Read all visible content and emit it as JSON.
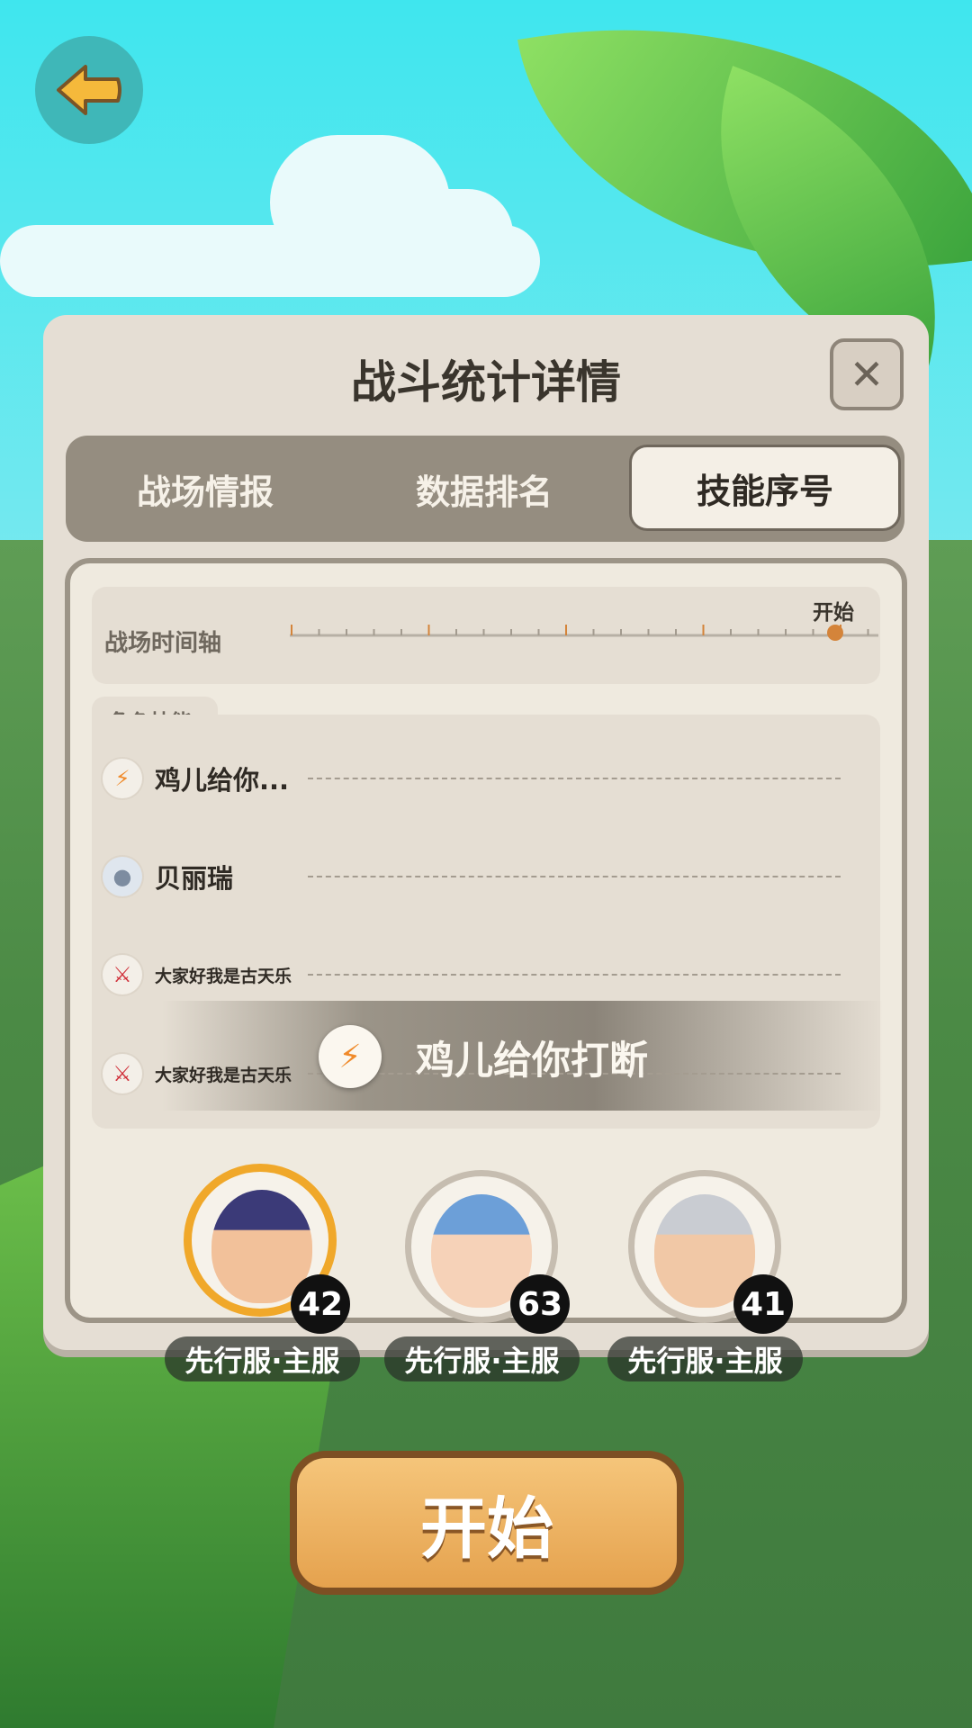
{
  "header": {
    "title": "战斗统计详情"
  },
  "tabs": [
    {
      "label": "战场情报",
      "active": false
    },
    {
      "label": "数据排名",
      "active": false
    },
    {
      "label": "技能序号",
      "active": true
    }
  ],
  "timeline": {
    "label": "战场时间轴",
    "start_label": "开始"
  },
  "skills": {
    "section_label": "角色技能",
    "rows": [
      {
        "name": "鸡儿给你...",
        "icon": "claw-skill-icon"
      },
      {
        "name": "贝丽瑞",
        "icon": "ghost-avatar-icon"
      },
      {
        "name": "大家好我是古天乐",
        "icon": "blade-skill-icon"
      },
      {
        "name": "大家好我是古天乐",
        "icon": "blade-skill-icon"
      }
    ],
    "banner_text": "鸡儿给你打断"
  },
  "players": [
    {
      "level": "42",
      "server": "先行服·主服",
      "selected": true
    },
    {
      "level": "63",
      "server": "先行服·主服",
      "selected": false
    },
    {
      "level": "41",
      "server": "先行服·主服",
      "selected": false
    }
  ],
  "start_button": {
    "label": "开始"
  },
  "colors": {
    "accent": "#f0a82a",
    "panel": "#e5ded4",
    "timeline_marker": "#d4843a"
  }
}
